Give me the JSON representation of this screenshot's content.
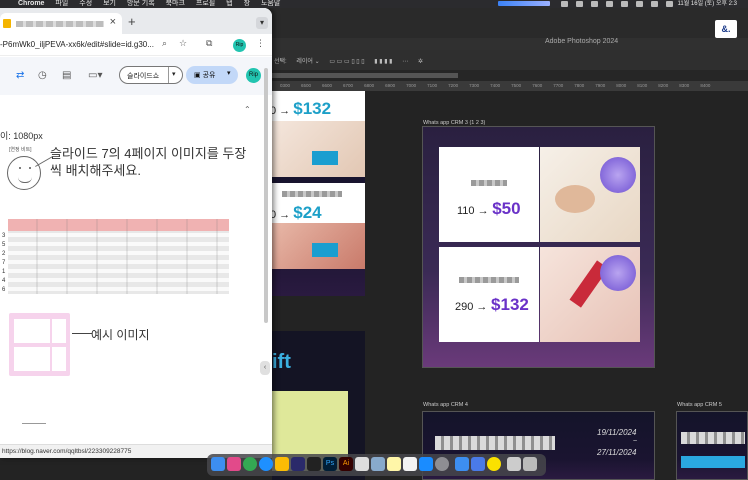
{
  "menubar": {
    "app": "Chrome",
    "items": [
      "파일",
      "수정",
      "보기",
      "방문 기록",
      "북마크",
      "프로필",
      "탭",
      "창",
      "도움말"
    ],
    "clock": "11월 16일 (토) 오후 2:3"
  },
  "chrome": {
    "tab_close": "×",
    "new_tab": "+",
    "url": "-P6mWk0_iljPEVA-xx6k/edit#slide=id.g30...",
    "avatar_text": "Rip",
    "slideshow_label": "슬라이드쇼",
    "share_label": "공유",
    "dropdown_caret": "▾",
    "collapse_caret": "⌃",
    "size_text": "이: 1080px",
    "face_tag": "[연정 비트]",
    "note_text": "슬라이드 7의 4페이지 이미지를 두장씩 배치해주세요.",
    "table_row_numbers": [
      "3",
      "5",
      "2",
      "7",
      "1",
      "4",
      "6"
    ],
    "example_label": "예시 이미지",
    "scroll_button": "‹",
    "status_url": "https://blog.naver.com/qqltbsl/223309228775"
  },
  "photoshop": {
    "title": "Adobe Photoshop 2024",
    "options": [
      "선택:",
      "레이어 ⌄",
      "⋯"
    ],
    "ruler_ticks": [
      "0300",
      "6500",
      "6600",
      "6700",
      "6800",
      "6900",
      "7000",
      "7100",
      "7200",
      "7300",
      "7400",
      "7500",
      "7600",
      "7700",
      "7800",
      "7900",
      "8000",
      "8100",
      "8200",
      "8300",
      "8400"
    ],
    "corner_logo": "&.",
    "artboards": {
      "crm3_label": "Whats app CRM 3 (1 2 3)",
      "crm4_label": "Whats app CRM 4",
      "crm5_label": "Whats app CRM 5",
      "p1_prefix": "110 →",
      "p1_price": "$50",
      "p2_prefix": "290 →",
      "p2_price": "$132",
      "left_top_prefix": "0 →",
      "left_top_price": "$132",
      "left_mid_prefix": "0 →",
      "left_mid_price": "$24",
      "gift_text": "ift",
      "date1": "19/11/2024",
      "date2": "27/11/2024",
      "date_sep": "~"
    }
  },
  "dock": {
    "apps": [
      "finder-icon",
      "launchpad-icon",
      "chrome-icon",
      "safari-icon",
      "drive-icon",
      "photoshop-icon",
      "illustrator-icon",
      "preview-icon",
      "notes-icon",
      "appstore-icon",
      "settings-icon",
      "kakaotalk-icon",
      "trash-icon"
    ]
  }
}
